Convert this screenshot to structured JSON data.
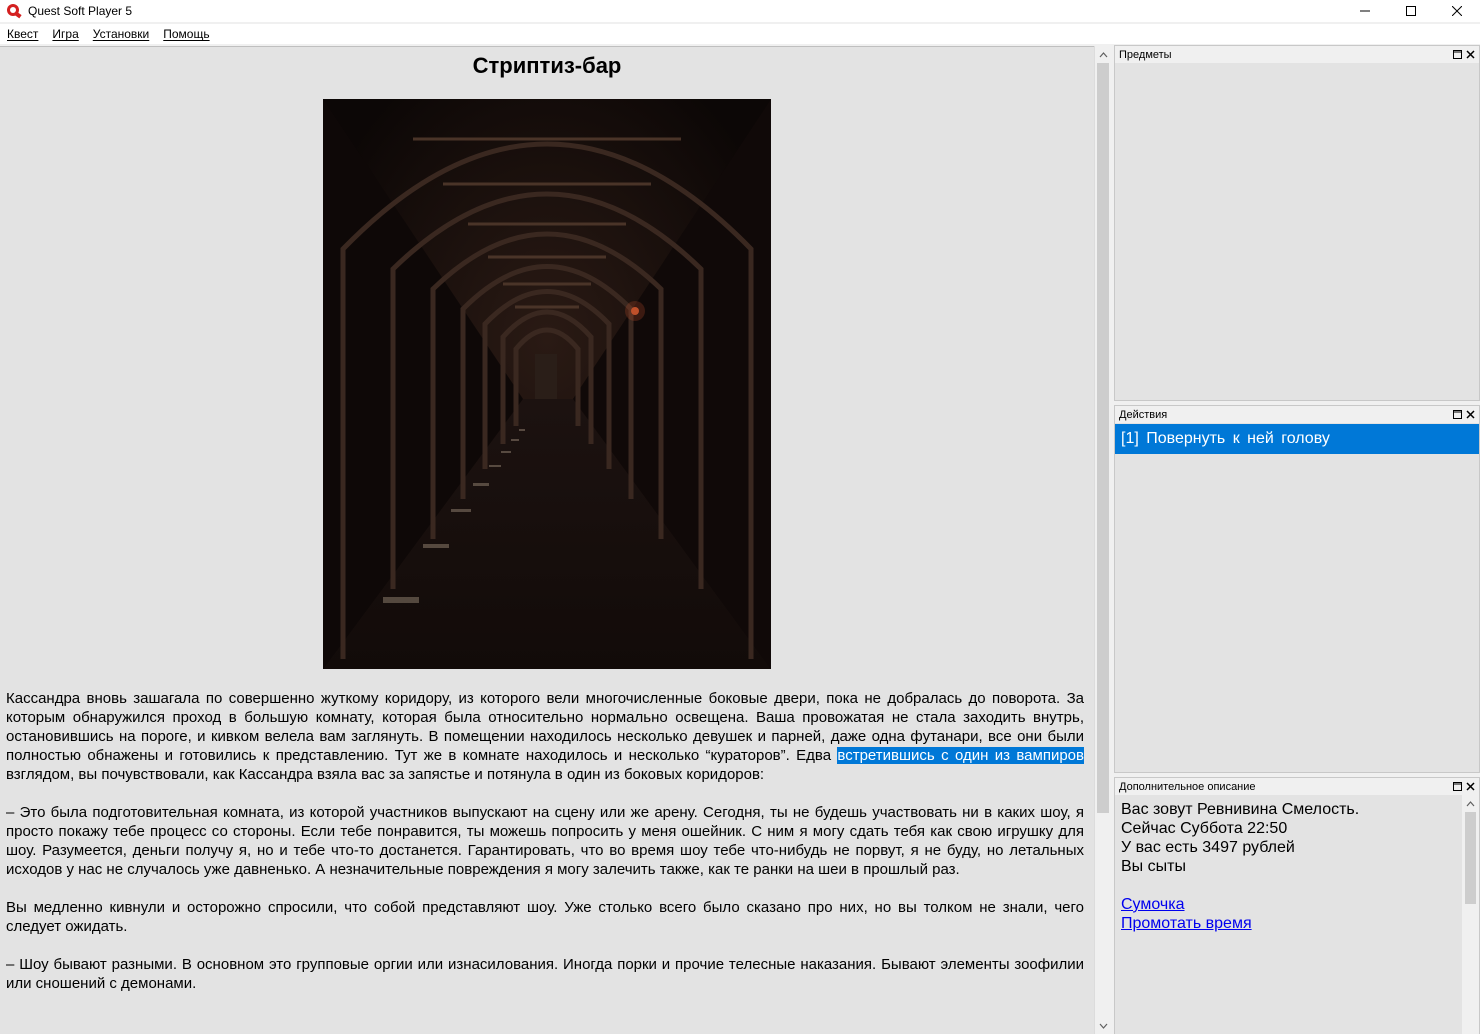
{
  "window": {
    "title": "Quest Soft Player 5"
  },
  "menu": {
    "items": [
      "Квест",
      "Игра",
      "Установки",
      "Помощь"
    ]
  },
  "main": {
    "title": "Стриптиз-бар",
    "image_icon": "dark-corridor-image",
    "paragraphs": [
      {
        "before": "Кассандра вновь зашагала по совершенно жуткому коридору, из которого вели многочисленные боковые двери, пока не добралась до поворота. За которым обнаружился проход в большую комнату, которая была относительно нормально освещена. Ваша провожатая не стала заходить внутрь, остановившись на пороге, и кивком велела вам заглянуть. В помещении находилось несколько девушек и парней, даже одна футанари, все они были полностью обнажены и готовились к представлению. Тут же в комнате находилось и несколько “кураторов”. Едва ",
        "selected": "встретившись с один из вампиров",
        "after": " взглядом, вы почувствовали, как Кассандра взяла вас за запястье и потянула в один из боковых коридоров:"
      },
      {
        "text": "– Это была подготовительная комната, из которой участников выпускают на сцену или же арену. Сегодня, ты не будешь участвовать ни в каких шоу, я просто покажу тебе процесс со стороны. Если тебе понравится, ты можешь попросить у меня ошейник. С ним я могу сдать тебя как свою игрушку для шоу. Разумеется, деньги получу я, но и тебе что-то достанется. Гарантировать, что во время шоу тебе что-нибудь не порвут, я не буду, но летальных исходов у нас не случалось уже давненько. А незначительные повреждения я могу залечить также, как те ранки на шеи в прошлый раз."
      },
      {
        "text": "Вы медленно кивнули и осторожно спросили, что собой представляют шоу. Уже столько всего было сказано про них, но вы толком не знали, чего следует ожидать."
      },
      {
        "text": "– Шоу бывают разными. В основном это групповые оргии или изнасилования. Иногда порки и прочие телесные наказания. Бывают элементы зоофилии или сношений с демонами."
      }
    ]
  },
  "panels": {
    "items": {
      "title": "Предметы"
    },
    "actions": {
      "title": "Действия",
      "list": [
        "[1] Повернуть к ней голову"
      ]
    },
    "description": {
      "title": "Дополнительное описание",
      "lines": [
        "Вас зовут Ревнивина Смелость.",
        "Сейчас Суббота 22:50",
        "У вас есть 3497 рублей",
        "Вы сыты"
      ],
      "links": [
        "Сумочка",
        "Промотать время"
      ]
    }
  },
  "colors": {
    "selection": "#0078d7",
    "link": "#0000ee",
    "panel_bg": "#e3e3e3"
  }
}
